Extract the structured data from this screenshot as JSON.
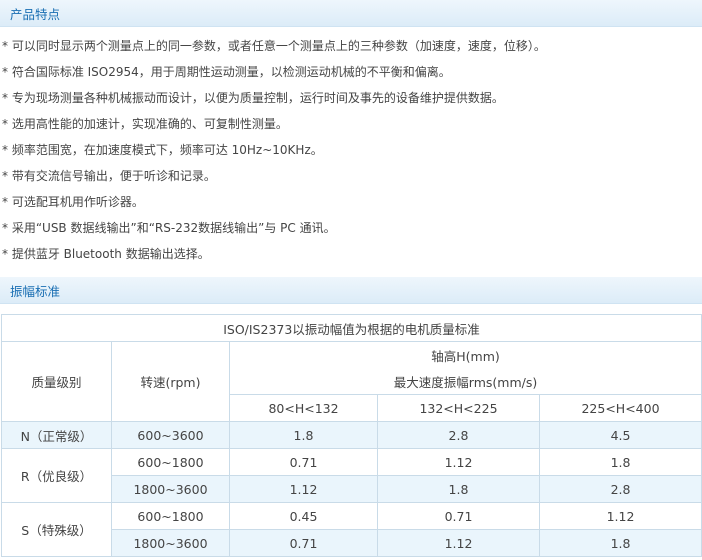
{
  "sections": {
    "features_title": "产品特点",
    "standard_title": "振幅标准"
  },
  "features": [
    "* 可以同时显示两个测量点上的同一参数，或者任意一个测量点上的三种参数（加速度，速度，位移）。",
    "* 符合国际标准 ISO2954，用于周期性运动测量，以检测运动机械的不平衡和偏离。",
    "* 专为现场测量各种机械振动而设计，以便为质量控制，运行时间及事先的设备维护提供数据。",
    "* 选用高性能的加速计，实现准确的、可复制性测量。",
    "* 频率范围宽，在加速度模式下，频率可达 10Hz~10KHz。",
    "* 带有交流信号输出，便于听诊和记录。",
    "* 可选配耳机用作听诊器。",
    "* 采用“USB 数据线输出”和“RS-232数据线输出”与 PC 通讯。",
    "* 提供蓝牙 Bluetooth 数据输出选择。"
  ],
  "table": {
    "caption": "ISO/IS2373以振动幅值为根据的电机质量标准",
    "header": {
      "grade": "质量级别",
      "speed": "转速(rpm)",
      "shaft_height": "轴高H(mm)",
      "max_velocity": "最大速度振幅rms(mm/s)",
      "ranges": [
        "80<H<132",
        "132<H<225",
        "225<H<400"
      ]
    },
    "grades": {
      "n": "N（正常级）",
      "r": "R（优良级）",
      "s": "S（特殊级）"
    },
    "rows": [
      {
        "speed": "600~3600",
        "values": [
          "1.8",
          "2.8",
          "4.5"
        ]
      },
      {
        "speed": "600~1800",
        "values": [
          "0.71",
          "1.12",
          "1.8"
        ]
      },
      {
        "speed": "1800~3600",
        "values": [
          "1.12",
          "1.8",
          "2.8"
        ]
      },
      {
        "speed": "600~1800",
        "values": [
          "0.45",
          "0.71",
          "1.12"
        ]
      },
      {
        "speed": "1800~3600",
        "values": [
          "0.71",
          "1.12",
          "1.8"
        ]
      }
    ]
  }
}
